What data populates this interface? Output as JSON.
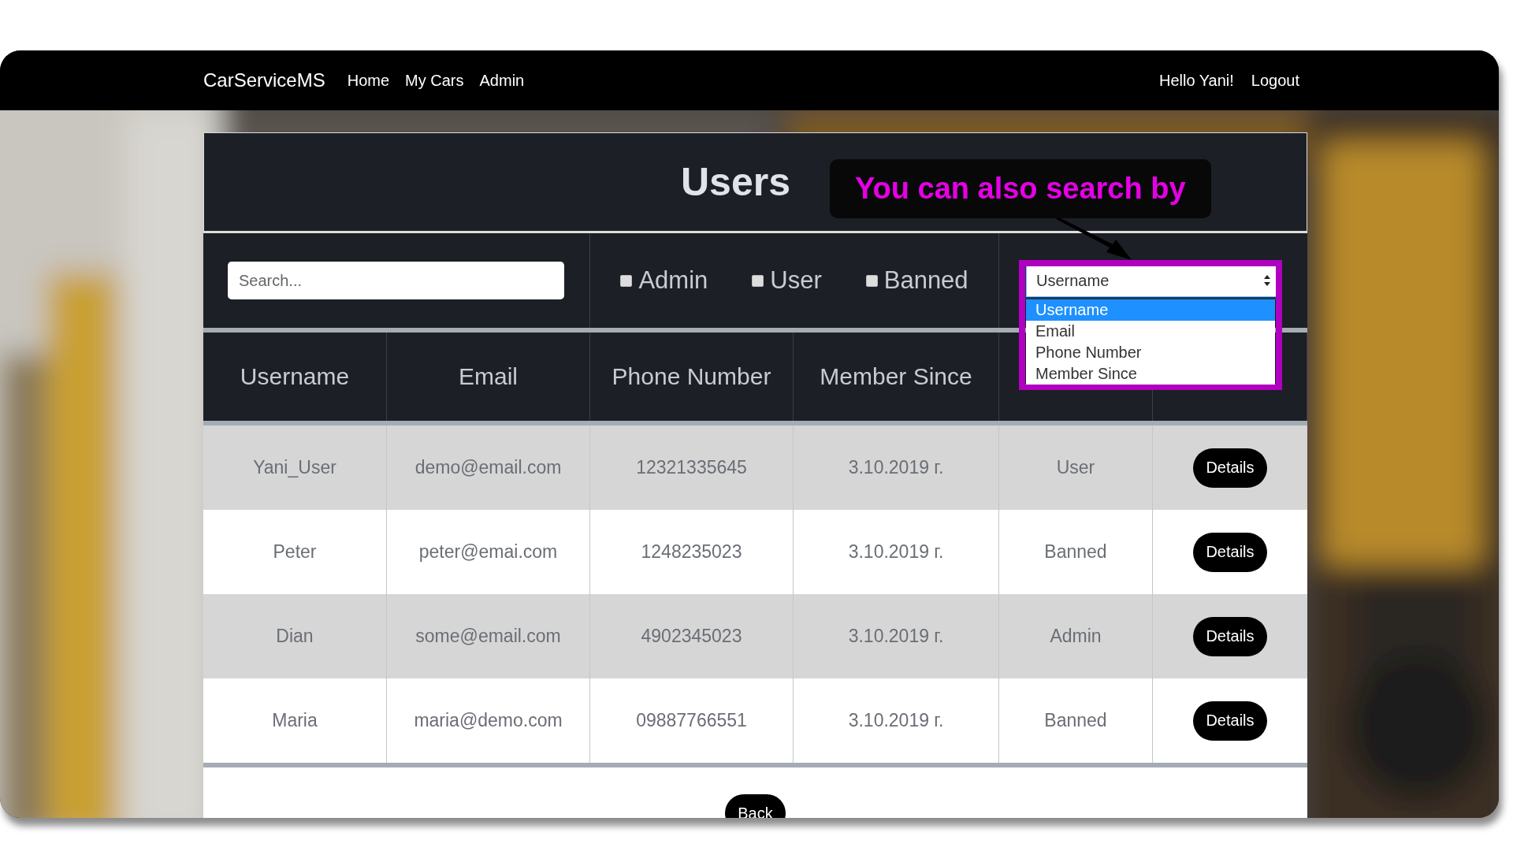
{
  "navbar": {
    "brand": "CarServiceMS",
    "links": [
      {
        "label": "Home"
      },
      {
        "label": "My Cars"
      },
      {
        "label": "Admin"
      }
    ],
    "greeting": "Hello Yani!",
    "logout": "Logout"
  },
  "page": {
    "title": "Users"
  },
  "callout": {
    "text": "You can also search by"
  },
  "filters": {
    "search": {
      "placeholder": "Search..."
    },
    "checkboxes": [
      {
        "label": "Admin",
        "checked": false
      },
      {
        "label": "User",
        "checked": false
      },
      {
        "label": "Banned",
        "checked": false
      }
    ],
    "search_by": {
      "value": "Username",
      "expanded": true,
      "options": [
        {
          "label": "Username",
          "selected": true
        },
        {
          "label": "Email",
          "selected": false
        },
        {
          "label": "Phone Number",
          "selected": false
        },
        {
          "label": "Member Since",
          "selected": false
        }
      ]
    }
  },
  "table": {
    "columns": [
      "Username",
      "Email",
      "Phone Number",
      "Member Since"
    ],
    "rows": [
      {
        "cells": [
          "Yani_User",
          "demo@email.com",
          "12321335645",
          "3.10.2019 г.",
          "User"
        ],
        "action": "Details"
      },
      {
        "cells": [
          "Peter",
          "peter@emai.com",
          "1248235023",
          "3.10.2019 г.",
          "Banned"
        ],
        "action": "Details"
      },
      {
        "cells": [
          "Dian",
          "some@email.com",
          "4902345023",
          "3.10.2019 г.",
          "Admin"
        ],
        "action": "Details"
      },
      {
        "cells": [
          "Maria",
          "maria@demo.com",
          "09887766551",
          "3.10.2019 г.",
          "Banned"
        ],
        "action": "Details"
      }
    ]
  },
  "back_button": "Back"
}
